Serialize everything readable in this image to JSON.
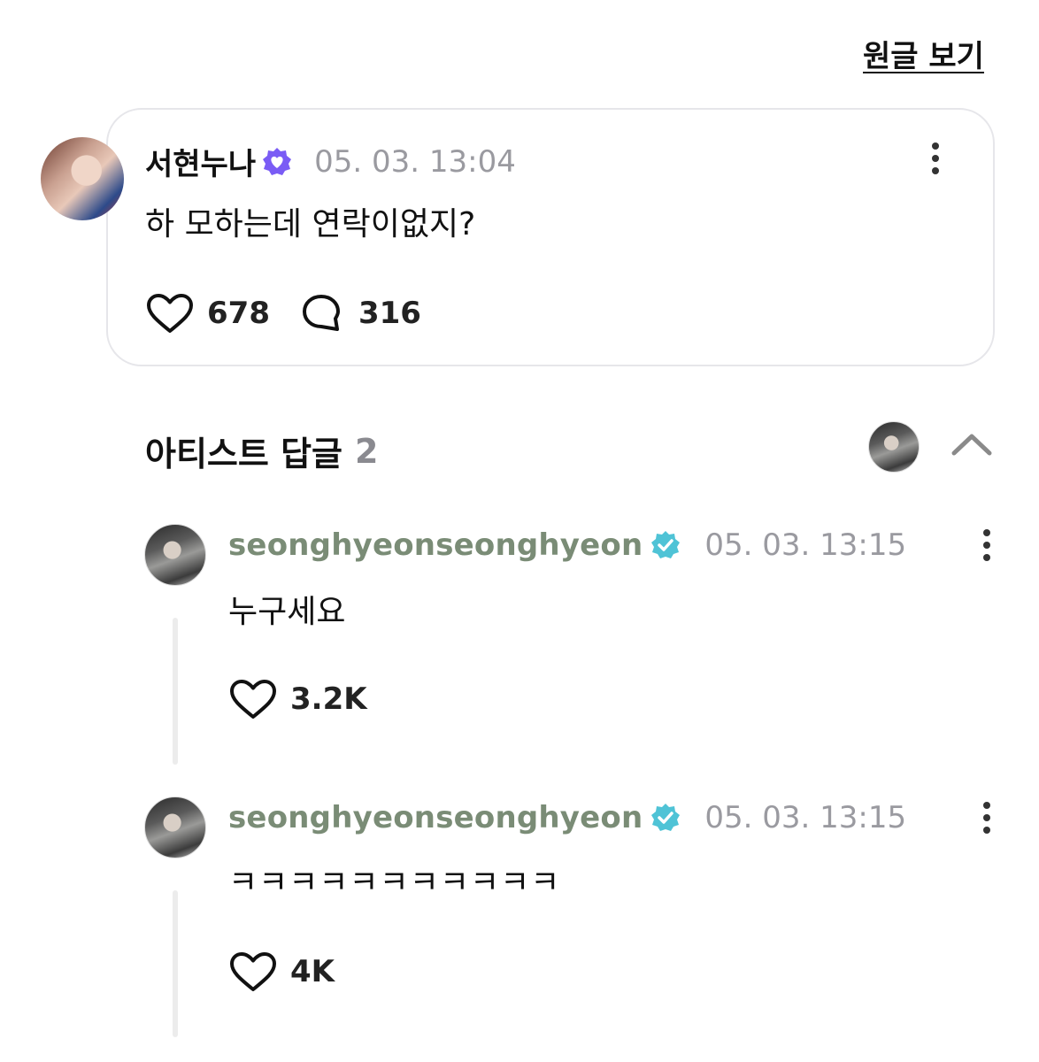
{
  "header": {
    "view_original_label": "원글 보기"
  },
  "post": {
    "author": "서현누나",
    "timestamp": "05. 03. 13:04",
    "text": "하 모하는데 연락이없지?",
    "likes": "678",
    "comments": "316",
    "badge_color": "#7a5cf5"
  },
  "artist_replies": {
    "title": "아티스트 답글",
    "count": "2",
    "replies": [
      {
        "author": "seonghyeonseonghyeon",
        "timestamp": "05. 03. 13:15",
        "text": "누구세요",
        "likes": "3.2K"
      },
      {
        "author": "seonghyeonseonghyeon",
        "timestamp": "05. 03. 13:15",
        "text": "ㅋㅋㅋㅋㅋㅋㅋㅋㅋㅋㅋ",
        "likes": "4K"
      }
    ],
    "badge_color": "#4fc3d6"
  }
}
